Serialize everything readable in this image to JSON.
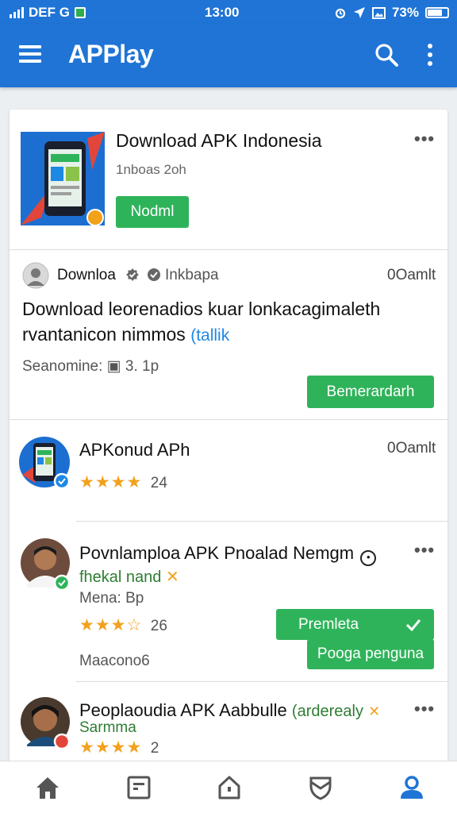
{
  "status_bar": {
    "carrier": "DEF G",
    "time": "13:00",
    "battery": "73%"
  },
  "app_bar": {
    "title": "APPlay",
    "icons": [
      "menu-icon",
      "search-icon",
      "more-vert-icon"
    ]
  },
  "feed": {
    "post1": {
      "title": "Download APK Indonesia",
      "meta": "1nboas 2oh",
      "button": "Nodml",
      "more": "•••"
    },
    "post2": {
      "author": "Downloa",
      "handle": "Inkbapa",
      "time": "0Oamlt",
      "body_line1": "Download leorenadios kuar lonkacagimaleth",
      "body_line2": "rvantanicon nimmos",
      "body_link": "(tallik",
      "stats": "Seanomine: ▣ 3. 1p",
      "button": "Bemerardarh"
    },
    "post3": {
      "title": "APKonud APh",
      "time": "0Oamlt",
      "stars": "★★★★",
      "count": "24"
    },
    "post4": {
      "title": "Povnlamploa APK Pnoalad Nemgm",
      "subtitle": "fhekal nand",
      "meta": "Mena: Bp",
      "stars": "★★★☆",
      "count": "26",
      "footer": "Maacono6",
      "button1": "Premleta",
      "button2": "Pooga penguna",
      "more": "•••"
    },
    "post5": {
      "title": "Peoplaoudia APK Aabbulle",
      "title_tag": "(arderealy",
      "subtitle": "Sarmma",
      "stars": "★★★★",
      "count": "2",
      "more": "•••"
    }
  },
  "bottom_nav": {
    "items": [
      "home-icon",
      "news-icon",
      "apps-icon",
      "shield-icon",
      "profile-icon"
    ],
    "active": "profile-icon"
  },
  "colors": {
    "primary": "#1f74d6",
    "green": "#2fb35a",
    "star": "#f2a11c",
    "link": "#1e88e5"
  }
}
